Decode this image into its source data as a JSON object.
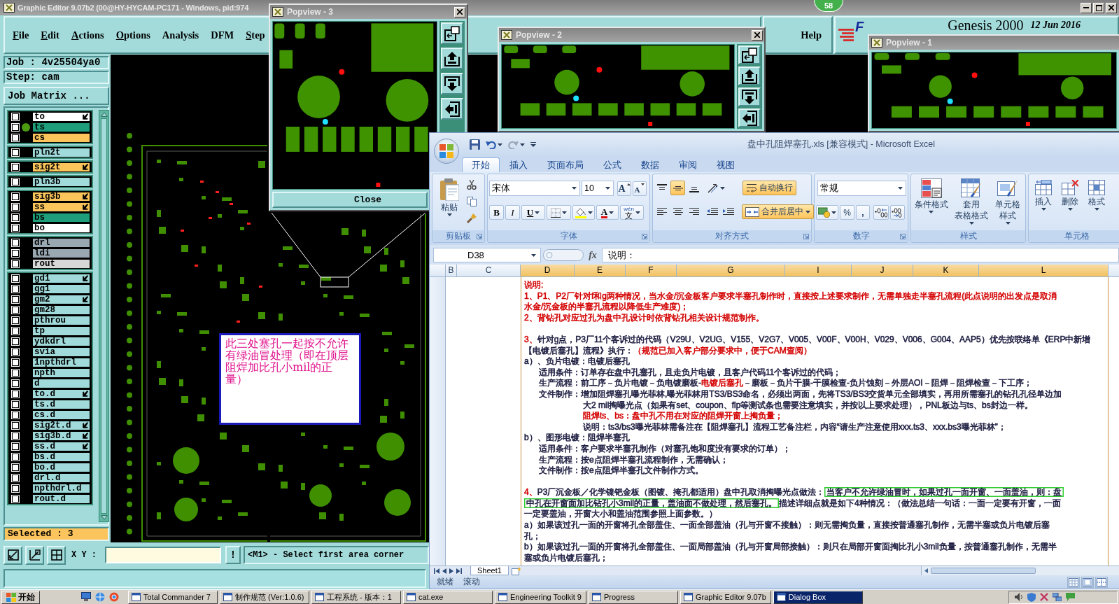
{
  "genesis_window": {
    "title": "Graphic Editor 9.07b2 (00@HY-HYCAM-PC171 - Windows, pid:974",
    "menu": [
      {
        "label": "File",
        "mnemonic": true
      },
      {
        "label": "Edit",
        "mnemonic": true
      },
      {
        "label": "Actions",
        "mnemonic": true
      },
      {
        "label": "Options",
        "mnemonic": true
      },
      {
        "label": "Analysis",
        "mnemonic": false
      },
      {
        "label": "DFM",
        "mnemonic": false
      },
      {
        "label": "Step",
        "mnemonic": true
      }
    ],
    "help": "Help",
    "brand": {
      "logo_letter": "F",
      "product": "Genesis 2000",
      "date": "12 Jun 2016"
    },
    "job": "Job : 4v25504ya0",
    "step": "Step: cam",
    "matrix_button": "Job Matrix ...",
    "layer_groups": [
      {
        "layers": [
          {
            "name": "to",
            "color": "#ffffff",
            "pointer": true,
            "active": false,
            "checked": false
          },
          {
            "name": "ts",
            "color": "#1e9e7a",
            "pointer": false,
            "active": true,
            "checked": false
          },
          {
            "name": "cs",
            "color": "#fbc55c",
            "pointer": false,
            "active": false,
            "checked": false
          }
        ]
      },
      {
        "layers": [
          {
            "name": "pln2t",
            "color": "#a0dada",
            "pointer": false,
            "active": false,
            "checked": false
          }
        ]
      },
      {
        "layers": [
          {
            "name": "sig2t",
            "color": "#fbc55c",
            "pointer": true,
            "active": false,
            "checked": false
          }
        ]
      },
      {
        "layers": [
          {
            "name": "pln3b",
            "color": "#a0dada",
            "pointer": false,
            "active": false,
            "checked": false
          }
        ]
      },
      {
        "layers": [
          {
            "name": "sig3b",
            "color": "#fbc55c",
            "pointer": true,
            "active": false,
            "checked": false
          },
          {
            "name": "ss",
            "color": "#fbc55c",
            "pointer": true,
            "active": false,
            "checked": false
          },
          {
            "name": "bs",
            "color": "#1e9e7a",
            "pointer": false,
            "active": false,
            "checked": false
          },
          {
            "name": "bo",
            "color": "#ffffff",
            "pointer": false,
            "active": false,
            "checked": false
          }
        ]
      },
      {
        "layers": [
          {
            "name": "drl",
            "color": "#9aa8b2",
            "pointer": false,
            "active": false,
            "checked": false
          },
          {
            "name": "ldi",
            "color": "#9aa8b2",
            "pointer": false,
            "active": false,
            "checked": false
          },
          {
            "name": "rout",
            "color": "#d8d8d8",
            "pointer": false,
            "active": false,
            "checked": false
          }
        ]
      },
      {
        "layers": [
          {
            "name": "gd1",
            "color": "#a0dada",
            "pointer": true,
            "active": false,
            "checked": false
          },
          {
            "name": "gg1",
            "color": "#a0dada",
            "pointer": false,
            "active": false,
            "checked": false
          },
          {
            "name": "gm2",
            "color": "#a0dada",
            "pointer": true,
            "active": false,
            "checked": false
          },
          {
            "name": "gm28",
            "color": "#a0dada",
            "pointer": false,
            "active": false,
            "checked": false
          },
          {
            "name": "pthrou",
            "color": "#a0dada",
            "pointer": false,
            "active": false,
            "checked": false
          },
          {
            "name": "tp",
            "color": "#a0dada",
            "pointer": false,
            "active": false,
            "checked": false
          },
          {
            "name": "ydkdrl",
            "color": "#a0dada",
            "pointer": false,
            "active": false,
            "checked": false
          },
          {
            "name": "svia",
            "color": "#a0dada",
            "pointer": false,
            "active": false,
            "checked": false
          },
          {
            "name": "1npthdrl",
            "color": "#a0dada",
            "pointer": false,
            "active": false,
            "checked": false
          },
          {
            "name": "npth",
            "color": "#a0dada",
            "pointer": false,
            "active": false,
            "checked": false
          },
          {
            "name": "d",
            "color": "#a0dada",
            "pointer": false,
            "active": false,
            "checked": false
          },
          {
            "name": "to.d",
            "color": "#a0dada",
            "pointer": true,
            "active": false,
            "checked": false
          },
          {
            "name": "ts.d",
            "color": "#a0dada",
            "pointer": false,
            "active": false,
            "checked": false
          },
          {
            "name": "cs.d",
            "color": "#a0dada",
            "pointer": false,
            "active": false,
            "checked": false
          },
          {
            "name": "sig2t.d",
            "color": "#a0dada",
            "pointer": true,
            "active": false,
            "checked": false
          },
          {
            "name": "sig3b.d",
            "color": "#a0dada",
            "pointer": true,
            "active": false,
            "checked": false
          },
          {
            "name": "ss.d",
            "color": "#a0dada",
            "pointer": true,
            "active": false,
            "checked": false
          },
          {
            "name": "bs.d",
            "color": "#a0dada",
            "pointer": false,
            "active": false,
            "checked": false
          },
          {
            "name": "bo.d",
            "color": "#a0dada",
            "pointer": false,
            "active": false,
            "checked": false
          },
          {
            "name": "drl.d",
            "color": "#a0dada",
            "pointer": false,
            "active": false,
            "checked": false
          },
          {
            "name": "npthdrl.d",
            "color": "#a0dada",
            "pointer": false,
            "active": false,
            "checked": false
          },
          {
            "name": "rout.d",
            "color": "#a0dada",
            "pointer": false,
            "active": false,
            "checked": false
          }
        ]
      }
    ],
    "selected_count": "Selected : 3",
    "xy_label": "X Y :",
    "alert_button": "!",
    "prompt": "<M1> - Select first area corner",
    "note": "此三处塞孔一起按不允许有绿油冒处理（即在顶层阻焊加比孔小mil的正量）"
  },
  "badge": "58",
  "popviews": [
    {
      "title": "Popview - 3",
      "close_icon": true,
      "tool_buttons": true,
      "close_button": "Close"
    },
    {
      "title": "Popview - 2",
      "close_icon": true,
      "tool_buttons": true
    },
    {
      "title": "Popview - 1",
      "close_icon": false,
      "tool_buttons": false
    }
  ],
  "excel": {
    "title": "盘中孔阻焊塞孔.xls  [兼容模式] - Microsoft Excel",
    "tabs": [
      {
        "label": "开始",
        "selected": true
      },
      {
        "label": "插入",
        "selected": false
      },
      {
        "label": "页面布局",
        "selected": false
      },
      {
        "label": "公式",
        "selected": false
      },
      {
        "label": "数据",
        "selected": false
      },
      {
        "label": "审阅",
        "selected": false
      },
      {
        "label": "视图",
        "selected": false
      }
    ],
    "ribbon": {
      "clipboard": {
        "label": "剪贴板",
        "paste": "粘贴"
      },
      "font": {
        "label": "字体",
        "name": "宋体",
        "size": "10",
        "grow": "A",
        "shrink": "A",
        "styles": [
          {
            "label": "B",
            "kind": "bold"
          },
          {
            "label": "I",
            "kind": "italic"
          },
          {
            "label": "U",
            "kind": "underline"
          }
        ],
        "color_letter": "A",
        "phonetic": [
          "wén",
          "文"
        ]
      },
      "alignment": {
        "label": "对齐方式",
        "vertical": [
          {
            "selected": false
          },
          {
            "selected": true
          },
          {
            "selected": false
          }
        ],
        "horizontal": [
          {
            "selected": false
          },
          {
            "selected": false
          },
          {
            "selected": false
          }
        ],
        "wrap": {
          "label": "自动换行",
          "on": true
        },
        "merge": {
          "label": "合并后居中",
          "on": true
        }
      },
      "number": {
        "label": "数字",
        "format": "常规",
        "percent": "%",
        "comma": ","
      },
      "styles": {
        "label": "样式",
        "buttons": [
          {
            "kind": "conditional",
            "lines": [
              "条件格式"
            ]
          },
          {
            "kind": "table",
            "lines": [
              "套用",
              "表格格式"
            ]
          },
          {
            "kind": "cell",
            "lines": [
              "单元格",
              "样式"
            ]
          }
        ]
      },
      "cells": {
        "label": "单元格",
        "buttons": [
          {
            "kind": "insert",
            "label": "插入"
          },
          {
            "kind": "delete",
            "label": "删除"
          },
          {
            "kind": "format",
            "label": "格式"
          }
        ]
      }
    },
    "name_box": "D38",
    "fx": "fx",
    "formula": "说明：",
    "columns": [
      {
        "label": "B",
        "selected": false
      },
      {
        "label": "C",
        "selected": false
      },
      {
        "label": "D",
        "selected": true
      },
      {
        "label": "E",
        "selected": true
      },
      {
        "label": "F",
        "selected": true
      },
      {
        "label": "G",
        "selected": true
      },
      {
        "label": "I",
        "selected": true
      },
      {
        "label": "J",
        "selected": true
      },
      {
        "label": "K",
        "selected": true
      },
      {
        "label": "L",
        "selected": true
      }
    ],
    "paragraphs": [
      {
        "lines": [
          {
            "kind": "plain",
            "segments": [
              {
                "text": "说明:",
                "color": "#d40000"
              }
            ]
          },
          {
            "kind": "plain",
            "segments": [
              {
                "text": "1、P1、P2厂针对f和g两种情况，当水金/沉金板客户要求半塞孔制作时，直接按上述要求制作，无需单独走半塞孔流程(此点说明的出发点是取消",
                "color": "#d40000"
              }
            ]
          },
          {
            "kind": "plain",
            "segments": [
              {
                "text": "水金/沉金板的半塞孔流程以降低生产难度)；",
                "color": "#d40000"
              }
            ]
          },
          {
            "kind": "plain",
            "segments": [
              {
                "text": "2、背钻孔对应过孔为盘中孔设计时依背钻孔相关设计规范制作。",
                "color": "#d40000"
              }
            ]
          }
        ]
      },
      {
        "lines": [
          {
            "kind": "plain",
            "segments": [
              {
                "text": "3、",
                "color": "#d40000"
              },
              {
                "text": "针对g点，P3厂11个客诉过的代码（V29U、V2UG、V155、V2G7、V005、V00F、V00H、V029、V006、G004、AAP5）优先按联络单《ERP中新增",
                "color": "#1c1c40"
              }
            ]
          },
          {
            "kind": "plain",
            "segments": [
              {
                "text": "【电镀后塞孔】流程》执行：",
                "color": "#1c1c40"
              },
              {
                "text": "（规范已加入客户部分要求中，便于CAM查阅）",
                "color": "#d40000"
              }
            ]
          },
          {
            "kind": "plain",
            "segments": [
              {
                "text": "a）、负片电镀：电镀后塞孔",
                "color": "#1c1c40"
              }
            ]
          },
          {
            "kind": "indented",
            "segments": [
              {
                "text": "适用条件：订单存在盘中孔塞孔，且走负片电镀，且客户代码11个客诉过的代码；",
                "color": "#1c1c40"
              }
            ]
          },
          {
            "kind": "indented",
            "segments": [
              {
                "text": "生产流程：前工序－负片电镀－负电镀磨板-",
                "color": "#1c1c40"
              },
              {
                "text": "电镀后塞孔",
                "color": "#d40000"
              },
              {
                "text": "－磨板－负片干膜-干膜检查-负片蚀刻－外层AOI－阻焊－阻焊检查－下工序；",
                "color": "#1c1c40"
              }
            ]
          },
          {
            "kind": "indented",
            "segments": [
              {
                "text": "文件制作：增加阻焊塞孔曝光菲林,曝光菲林用TS3/BS3命名，必须出两面，先将TS3/BS3交货单元全部填实，再用所需塞孔的钻孔孔径单边加",
                "color": "#1c1c40"
              }
            ]
          },
          {
            "kind": "hanging",
            "segments": [
              {
                "text": "大2 mil掏曝光点（如果有set、coupon、flp等测试条也需要注意填实，并按以上要求处理），PNL板边与ts、bs封边一样。",
                "color": "#1c1c40"
              }
            ]
          },
          {
            "kind": "hanging",
            "segments": [
              {
                "text": "阻焊ts、bs：盘中孔不用在对应的阻焊开窗上掏负量；",
                "color": "#d40000"
              }
            ]
          },
          {
            "kind": "hanging",
            "segments": [
              {
                "text": "说明：ts3/bs3曝光菲林需备注在【阻焊塞孔】流程工艺备注栏，内容“请生产注意使用xxx.ts3、xxx.bs3曝光菲林”；",
                "color": "#1c1c40"
              }
            ]
          },
          {
            "kind": "plain",
            "segments": [
              {
                "text": "b）、图形电镀：阻焊半塞孔",
                "color": "#1c1c40"
              }
            ]
          },
          {
            "kind": "indented",
            "segments": [
              {
                "text": "适用条件：客户要求半塞孔制作（对塞孔饱和度没有要求的订单）；",
                "color": "#1c1c40"
              }
            ]
          },
          {
            "kind": "indented",
            "segments": [
              {
                "text": "生产流程：按e点阻焊半塞孔流程制作，无需确认；",
                "color": "#1c1c40"
              }
            ]
          },
          {
            "kind": "indented",
            "segments": [
              {
                "text": "文件制作：按e点阻焊半塞孔文件制作方式。",
                "color": "#1c1c40"
              }
            ]
          }
        ]
      },
      {
        "lines": [
          {
            "kind": "plain",
            "segments": [
              {
                "text": "4、",
                "color": "#d40000",
                "highlighted": false
              },
              {
                "text": "P3厂沉金板／化学镍钯金板（图镀、掩孔都适用）盘中孔取消掏曝光点做法：",
                "color": "#1c1c40",
                "highlighted": false
              },
              {
                "text": "当客户不允许绿油冒时，如果过孔一面开窗、一面盖油，则：盘",
                "color": "#1c1c40",
                "highlighted": true
              }
            ]
          },
          {
            "kind": "plain",
            "segments": [
              {
                "text": "中孔在开窗面加比钻孔小3mil的正量，盖油面不做处理，然后塞孔。",
                "color": "#1c1c40",
                "highlighted": true
              },
              {
                "text": "描述详细点就是如下4种情况：（做法总结一句话：一面一定要有开窗，一面",
                "color": "#1c1c40",
                "highlighted": false
              }
            ]
          },
          {
            "kind": "plain",
            "segments": [
              {
                "text": "一定要盖油，开窗大小和盖油范围参照上面参数。）",
                "color": "#1c1c40"
              }
            ]
          },
          {
            "kind": "plain",
            "segments": [
              {
                "text": "a）如果该过孔一面的开窗将孔全部盖住、一面全部盖油（孔与开窗不接触）：则无需掏负量，直接按普通塞孔制作，无需半塞或负片电镀后塞",
                "color": "#1c1c40"
              }
            ]
          },
          {
            "kind": "plain",
            "segments": [
              {
                "text": "孔；",
                "color": "#1c1c40"
              }
            ]
          },
          {
            "kind": "plain",
            "segments": [
              {
                "text": "b）如果该过孔一面的开窗将孔全部盖住、一面局部盖油（孔与开窗局部接触）：则只在局部开窗面掏比孔小3mil负量，按普通塞孔制作，无需半",
                "color": "#1c1c40"
              }
            ]
          },
          {
            "kind": "plain",
            "segments": [
              {
                "text": "塞或负片电镀后塞孔；",
                "color": "#1c1c40"
              }
            ]
          }
        ]
      }
    ],
    "sheet_tabs": [
      {
        "label": "Sheet1",
        "selected": true
      }
    ],
    "status": [
      "就绪",
      "滚动"
    ]
  },
  "taskbar": {
    "start": "开始",
    "items": [
      {
        "label": "Total Commander 7",
        "selected": false
      },
      {
        "label": "制作规范 (Ver:1.0.6)",
        "selected": false
      },
      {
        "label": "工程系统 - 版本：1",
        "selected": false
      },
      {
        "label": "cat.exe",
        "selected": false
      },
      {
        "label": "Engineering Toolkit 9",
        "selected": false
      },
      {
        "label": "Progress",
        "selected": false
      },
      {
        "label": "Graphic Editor 9.07b",
        "selected": false
      },
      {
        "label": "Dialog Box",
        "selected": true
      }
    ]
  }
}
